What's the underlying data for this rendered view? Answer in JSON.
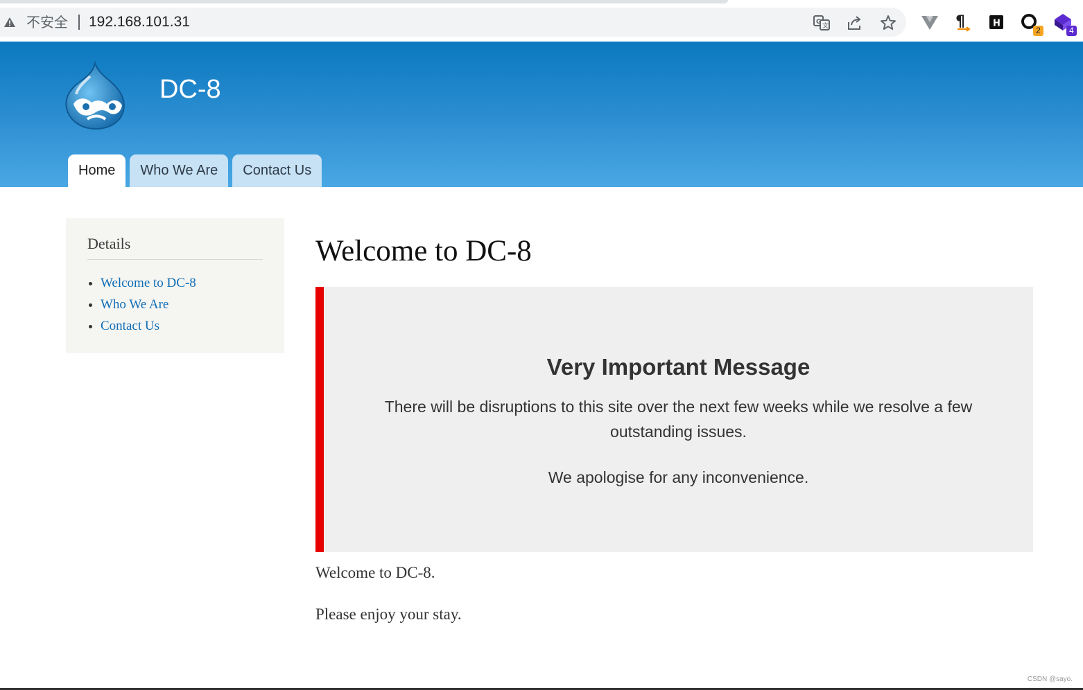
{
  "browser": {
    "security_label": "不安全",
    "url": "192.168.101.31",
    "extensions": [
      {
        "icon": "vue-devtools-icon"
      },
      {
        "icon": "pilcrow-icon"
      },
      {
        "icon": "h-extension-icon"
      },
      {
        "icon": "search-extension-icon",
        "badge": "2"
      },
      {
        "icon": "cube-extension-icon",
        "badge": "4"
      }
    ],
    "colors": {
      "badge_orange": "#f5a623",
      "badge_purple": "#5b2ad1"
    }
  },
  "header": {
    "site_name": "DC-8",
    "tabs": [
      {
        "label": "Home",
        "active": true
      },
      {
        "label": "Who We Are",
        "active": false
      },
      {
        "label": "Contact Us",
        "active": false
      }
    ],
    "colors": {
      "gradient_top": "#0a78bf",
      "gradient_bottom": "#49a8e4"
    }
  },
  "sidebar": {
    "title": "Details",
    "items": [
      {
        "label": "Welcome to DC-8"
      },
      {
        "label": "Who We Are"
      },
      {
        "label": "Contact Us"
      }
    ]
  },
  "main": {
    "title": "Welcome to DC-8",
    "notice": {
      "title": "Very Important Message",
      "paragraph1": "There will be disruptions to this site over the next few weeks while we resolve a few outstanding issues.",
      "paragraph2": "We apologise for any inconvenience.",
      "accent_color": "#e60000"
    },
    "paragraphs": [
      "Welcome to DC-8.",
      "Please enjoy your stay."
    ]
  },
  "watermark": "CSDN @sayo."
}
